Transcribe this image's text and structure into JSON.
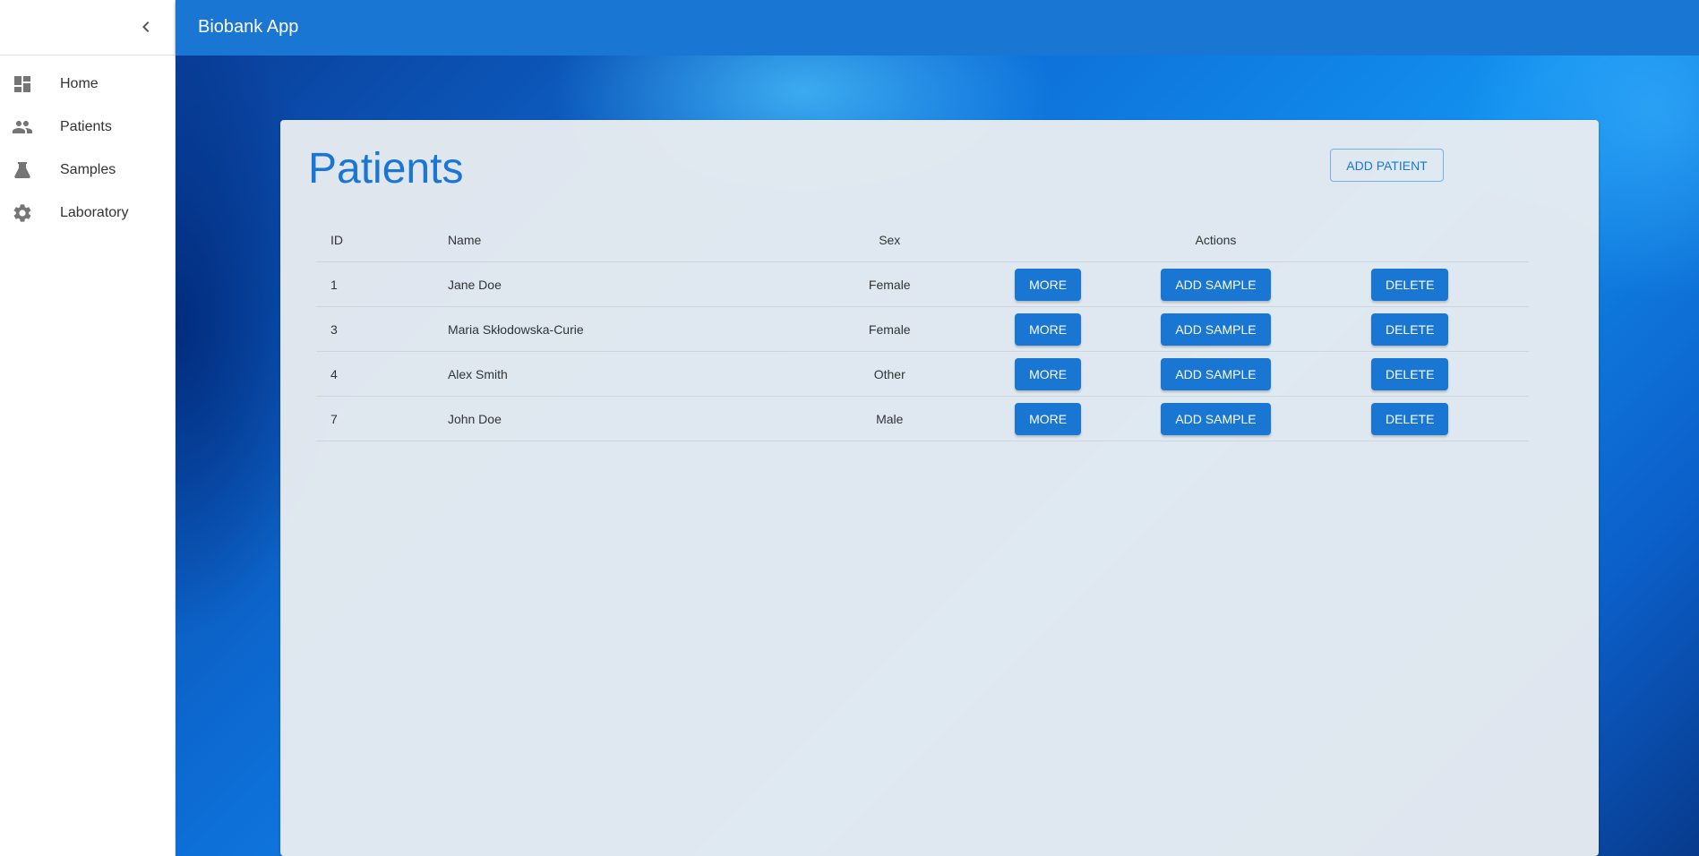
{
  "app": {
    "title": "Biobank App"
  },
  "sidebar": {
    "items": [
      {
        "label": "Home",
        "icon": "dashboard-icon"
      },
      {
        "label": "Patients",
        "icon": "people-icon"
      },
      {
        "label": "Samples",
        "icon": "flask-icon"
      },
      {
        "label": "Laboratory",
        "icon": "gear-icon"
      }
    ]
  },
  "page": {
    "title": "Patients",
    "add_button": "ADD PATIENT"
  },
  "table": {
    "headers": {
      "id": "ID",
      "name": "Name",
      "sex": "Sex",
      "actions": "Actions"
    },
    "rows": [
      {
        "id": "1",
        "name": "Jane Doe",
        "sex": "Female"
      },
      {
        "id": "3",
        "name": "Maria Skłodowska-Curie",
        "sex": "Female"
      },
      {
        "id": "4",
        "name": "Alex Smith",
        "sex": "Other"
      },
      {
        "id": "7",
        "name": "John Doe",
        "sex": "Male"
      }
    ],
    "actions": {
      "more": "MORE",
      "add_sample": "ADD SAMPLE",
      "delete": "DELETE"
    }
  },
  "colors": {
    "primary": "#1976d2"
  }
}
